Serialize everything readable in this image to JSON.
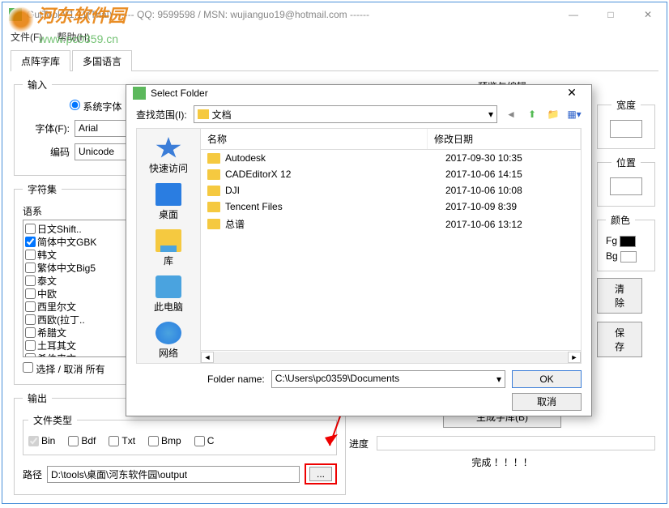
{
  "window": {
    "title": "GuiTool V1.11(Trial) ------ QQ: 9599598 / MSN: wujianguo19@hotmail.com ------",
    "menu": {
      "file": "文件(F)",
      "help": "帮助(H)"
    },
    "win_min": "—",
    "win_max": "□",
    "win_close": "✕"
  },
  "watermark": {
    "line1": "河东软件园",
    "line2": "www.pc0359.cn"
  },
  "tabs": {
    "t1": "点阵字库",
    "t2": "多国语言"
  },
  "input": {
    "legend": "输入",
    "sys_font": "系统字体",
    "font_label": "字体(F):",
    "font_value": "Arial",
    "enc_label": "编码",
    "enc_value": "Unicode"
  },
  "charset": {
    "legend": "字符集",
    "lang_label": "语系",
    "items": [
      "日文Shift..",
      "简体中文GBK",
      "韩文",
      "繁体中文Big5",
      "泰文",
      "中欧",
      "西里尔文",
      "西欧(拉丁..",
      "希腊文",
      "土耳其文",
      "希伯来文"
    ],
    "checked_index": 1,
    "select_cancel": "选择 / 取消 所有"
  },
  "preview": {
    "title": "预览与编辑"
  },
  "right": {
    "width_legend": "宽度",
    "pos_legend": "位置",
    "color_legend": "颜色",
    "fg": "Fg",
    "bg": "Bg",
    "clear": "清除",
    "save": "保存"
  },
  "gen_font": "生成字库(B)",
  "progress_label": "进度",
  "done": "完成 ！！！！",
  "output": {
    "legend": "输出",
    "type_legend": "文件类型",
    "bin": "Bin",
    "bdf": "Bdf",
    "txt": "Txt",
    "bmp": "Bmp",
    "c": "C",
    "path_label": "路径",
    "path_value": "D:\\tools\\桌面\\河东软件园\\output",
    "browse": "..."
  },
  "dialog": {
    "title": "Select Folder",
    "look_label": "查找范围(I):",
    "look_value": "文档",
    "col_name": "名称",
    "col_date": "修改日期",
    "places": {
      "quick": "快速访问",
      "desktop": "桌面",
      "lib": "库",
      "pc": "此电脑",
      "net": "网络"
    },
    "rows": [
      {
        "name": "Autodesk",
        "date": "2017-09-30 10:35"
      },
      {
        "name": "CADEditorX 12",
        "date": "2017-10-06 14:15"
      },
      {
        "name": "DJI",
        "date": "2017-10-06 10:08"
      },
      {
        "name": "Tencent Files",
        "date": "2017-10-09 8:39"
      },
      {
        "name": "总谱",
        "date": "2017-10-06 13:12"
      }
    ],
    "folder_name_label": "Folder name:",
    "folder_name_value": "C:\\Users\\pc0359\\Documents",
    "ok": "OK",
    "cancel": "取消"
  }
}
